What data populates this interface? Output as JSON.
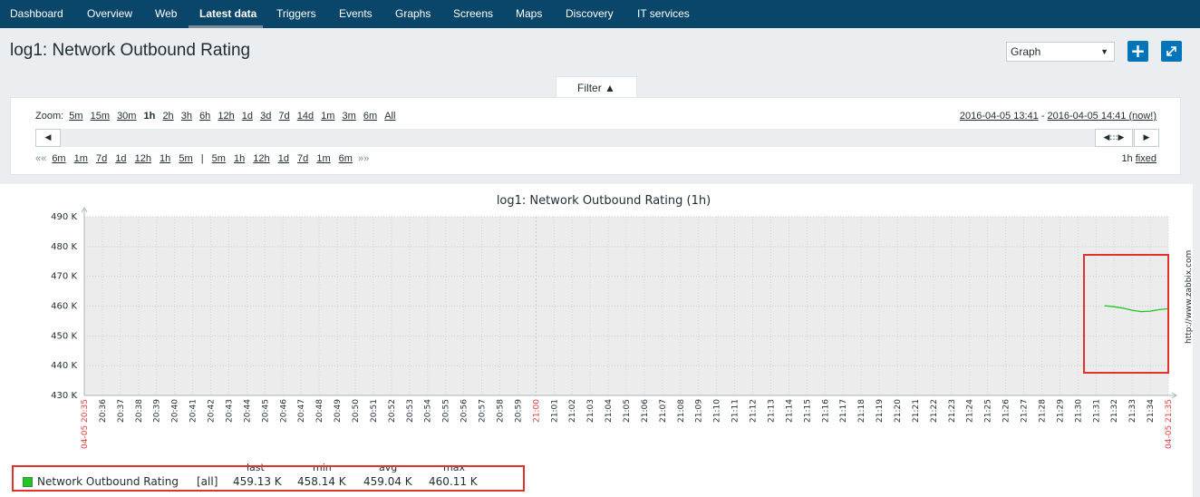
{
  "nav": {
    "items": [
      "Dashboard",
      "Overview",
      "Web",
      "Latest data",
      "Triggers",
      "Events",
      "Graphs",
      "Screens",
      "Maps",
      "Discovery",
      "IT services"
    ],
    "active": "Latest data"
  },
  "page": {
    "title": "log1: Network Outbound Rating",
    "view_select": "Graph"
  },
  "filter": {
    "tab_label": "Filter ▲",
    "zoom_label": "Zoom:",
    "zoom_options": [
      "5m",
      "15m",
      "30m",
      "1h",
      "2h",
      "3h",
      "6h",
      "12h",
      "1d",
      "3d",
      "7d",
      "14d",
      "1m",
      "3m",
      "6m",
      "All"
    ],
    "zoom_selected": "1h",
    "period_from": "2016-04-05 13:41",
    "period_sep": " - ",
    "period_to": "2016-04-05 14:41 (now!)",
    "back_arrows": "««",
    "back_options": [
      "6m",
      "1m",
      "7d",
      "1d",
      "12h",
      "1h",
      "5m"
    ],
    "separator": "|",
    "fwd_options": [
      "5m",
      "1h",
      "12h",
      "1d",
      "7d",
      "1m",
      "6m"
    ],
    "fwd_arrows": "»»",
    "period_len": "1h",
    "fixed_label": "fixed"
  },
  "graph": {
    "title": "log1: Network Outbound Rating (1h)",
    "watermark": "http://www.zabbix.com"
  },
  "chart_data": {
    "type": "line",
    "title": "log1: Network Outbound Rating (1h)",
    "y_ticks": [
      "490 K",
      "480 K",
      "470 K",
      "460 K",
      "450 K",
      "440 K",
      "430 K"
    ],
    "ylim": [
      430000,
      490000
    ],
    "x_ticks": [
      "04-05 20:35",
      "20:36",
      "20:37",
      "20:38",
      "20:39",
      "20:40",
      "20:41",
      "20:42",
      "20:43",
      "20:44",
      "20:45",
      "20:46",
      "20:47",
      "20:48",
      "20:49",
      "20:50",
      "20:51",
      "20:52",
      "20:53",
      "20:54",
      "20:55",
      "20:56",
      "20:57",
      "20:58",
      "20:59",
      "21:00",
      "21:01",
      "21:02",
      "21:03",
      "21:04",
      "21:05",
      "21:06",
      "21:07",
      "21:08",
      "21:09",
      "21:10",
      "21:11",
      "21:12",
      "21:13",
      "21:14",
      "21:15",
      "21:16",
      "21:17",
      "21:18",
      "21:19",
      "21:20",
      "21:21",
      "21:22",
      "21:23",
      "21:24",
      "21:25",
      "21:26",
      "21:27",
      "21:28",
      "21:29",
      "21:30",
      "21:31",
      "21:32",
      "21:33",
      "21:34",
      "04-05 21:35"
    ],
    "x_red_ticks": [
      "04-05 20:35",
      "21:00",
      "04-05 21:35"
    ],
    "grid": true,
    "series": [
      {
        "name": "Network Outbound Rating",
        "color": "#1ec81e",
        "x": [
          "21:31:30",
          "21:32:00",
          "21:32:30",
          "21:33:00",
          "21:33:30",
          "21:34:00",
          "21:34:30",
          "21:35:00"
        ],
        "values": [
          460110,
          459800,
          459300,
          458600,
          458140,
          458300,
          458800,
          459130
        ]
      }
    ],
    "legend": {
      "headers": [
        "last",
        "min",
        "avg",
        "max"
      ],
      "rows": [
        {
          "name": "Network Outbound Rating",
          "func": "[all]",
          "last": "459.13 K",
          "min": "458.14 K",
          "avg": "459.04 K",
          "max": "460.11 K"
        }
      ]
    }
  }
}
